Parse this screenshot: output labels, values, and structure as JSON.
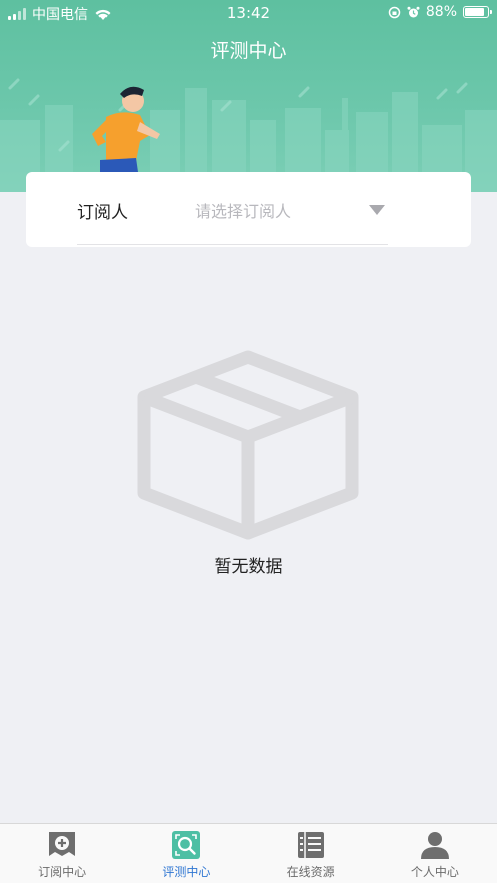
{
  "status": {
    "carrier": "中国电信",
    "time": "13:42",
    "battery": "88%",
    "battery_level": 0.88
  },
  "header": {
    "title": "评测中心"
  },
  "subscriber": {
    "label": "订阅人",
    "placeholder": "请选择订阅人"
  },
  "empty": {
    "message": "暂无数据"
  },
  "tabs": [
    {
      "label": "订阅中心",
      "icon": "subscribe-center-icon",
      "active": false
    },
    {
      "label": "评测中心",
      "icon": "evaluation-center-icon",
      "active": true
    },
    {
      "label": "在线资源",
      "icon": "online-resources-icon",
      "active": false
    },
    {
      "label": "个人中心",
      "icon": "personal-center-icon",
      "active": false
    }
  ],
  "colors": {
    "header": "#6cc7ab",
    "active_tab": "#2f76d2",
    "active_icon": "#4dbfa4",
    "inactive_icon": "#6e6e6e"
  }
}
